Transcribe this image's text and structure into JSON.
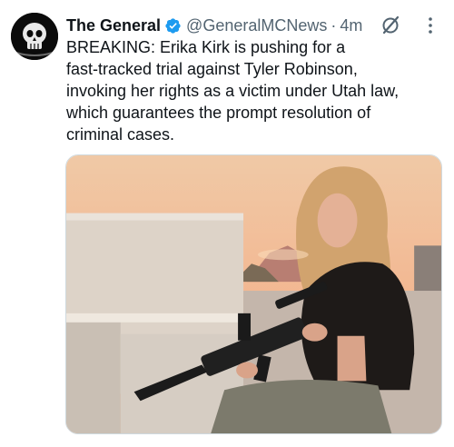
{
  "tweet": {
    "author_name": "The General",
    "handle": "@GeneralMCNews",
    "separator": "·",
    "time": "4m",
    "text": "BREAKING: Erika Kirk is pushing for a\nfast-tracked trial against Tyler Robinson,\ninvoking her rights as a victim under Utah law,\nwhich guarantees the prompt resolution of\ncriminal cases."
  },
  "icons": {
    "verified": "verified-badge-icon",
    "grok": "grok-icon",
    "more": "more-options-icon"
  },
  "colors": {
    "verified_blue": "#1d9bf0",
    "secondary_text": "#536471",
    "primary_text": "#0f1419"
  }
}
